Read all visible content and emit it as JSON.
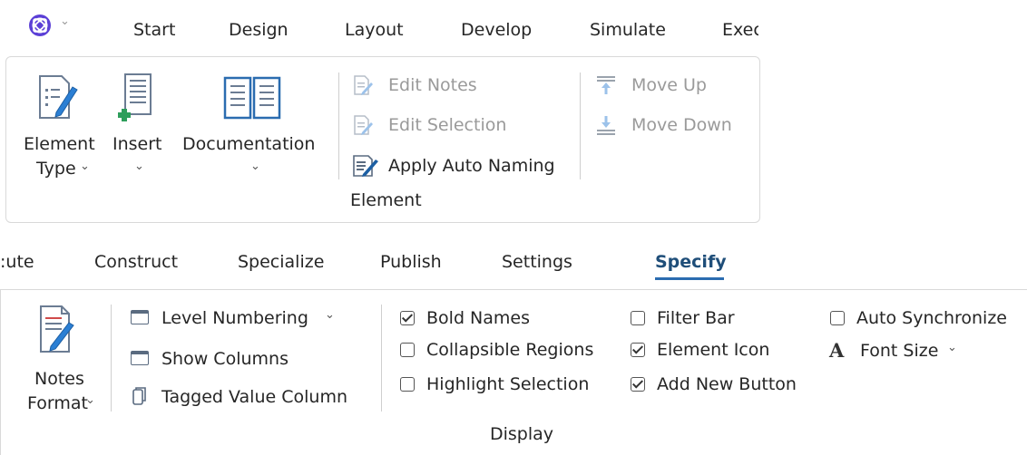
{
  "top": {
    "app_menu_chevron": "⌄",
    "tabs": [
      {
        "label": "Start"
      },
      {
        "label": "Design"
      },
      {
        "label": "Layout"
      },
      {
        "label": "Develop"
      },
      {
        "label": "Simulate"
      },
      {
        "label": "Exec"
      }
    ],
    "element_type": {
      "line1": "Element",
      "line2": "Type"
    },
    "insert": {
      "label": "Insert"
    },
    "documentation": {
      "label": "Documentation"
    },
    "edit_notes": "Edit Notes",
    "edit_selection": "Edit Selection",
    "apply_auto_naming": "Apply Auto Naming",
    "move_up": "Move Up",
    "move_down": "Move Down",
    "group_label": "Element"
  },
  "bottom": {
    "tabs": [
      {
        "label": ":ute"
      },
      {
        "label": "Construct"
      },
      {
        "label": "Specialize"
      },
      {
        "label": "Publish"
      },
      {
        "label": "Settings"
      },
      {
        "label": "Specify"
      }
    ],
    "notes_format": {
      "line1": "Notes",
      "line2": "Format"
    },
    "level_numbering": "Level Numbering",
    "show_columns": "Show Columns",
    "tagged_value_column": "Tagged Value Column",
    "checkboxes": {
      "bold_names": {
        "label": "Bold Names",
        "checked": true
      },
      "collapsible_regions": {
        "label": "Collapsible Regions",
        "checked": false
      },
      "highlight_selection": {
        "label": "Highlight Selection",
        "checked": false
      },
      "filter_bar": {
        "label": "Filter Bar",
        "checked": false
      },
      "element_icon": {
        "label": "Element Icon",
        "checked": true
      },
      "add_new_button": {
        "label": "Add New Button",
        "checked": true
      },
      "auto_synchronize": {
        "label": "Auto Synchronize",
        "checked": false
      }
    },
    "font_size": "Font Size",
    "font_size_glyph": "A",
    "group_label": "Display"
  }
}
